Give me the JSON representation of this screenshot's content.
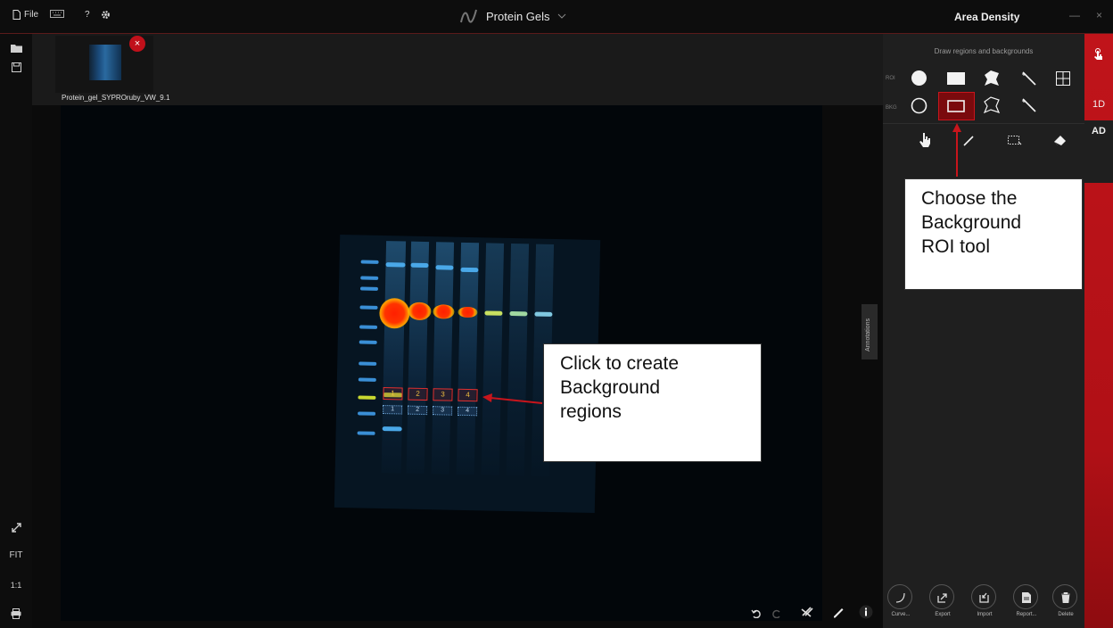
{
  "topbar": {
    "file_label": "File",
    "help_label": "?",
    "app_title": "Protein Gels",
    "panel_title": "Area Density",
    "minimize_label": "—",
    "close_label": "×"
  },
  "left_toolbar": {
    "fit_label": "FIT",
    "one_to_one_label": "1:1"
  },
  "thumbnail": {
    "name": "Protein_gel_SYPROruby_VW_9.1",
    "close_label": "×"
  },
  "gel": {
    "roi_labels": [
      "1",
      "2",
      "3",
      "4"
    ],
    "bkg_labels": [
      "1",
      "2",
      "3",
      "4"
    ]
  },
  "annotations_tab": {
    "label": "Annotations"
  },
  "right_panel": {
    "heading": "Draw regions and backgrounds",
    "roi_row_label": "ROI",
    "bkg_row_label": "BKG",
    "buttons": [
      {
        "label": "Curve...",
        "icon": "curve-icon"
      },
      {
        "label": "Export",
        "icon": "export-icon"
      },
      {
        "label": "Import",
        "icon": "import-icon"
      },
      {
        "label": "Report...",
        "icon": "report-icon"
      },
      {
        "label": "Delete",
        "icon": "trash-icon"
      }
    ]
  },
  "side_tabs": {
    "tab_1d": "1D",
    "tab_ad": "AD"
  },
  "callouts": {
    "choose_tool": [
      "Choose the",
      "Background",
      "ROI tool"
    ],
    "click_create": [
      "Click to create",
      "Background",
      "regions"
    ]
  },
  "colors": {
    "accent": "#c0141a",
    "panel": "#1f1f1f",
    "background": "#0b0b0b"
  }
}
